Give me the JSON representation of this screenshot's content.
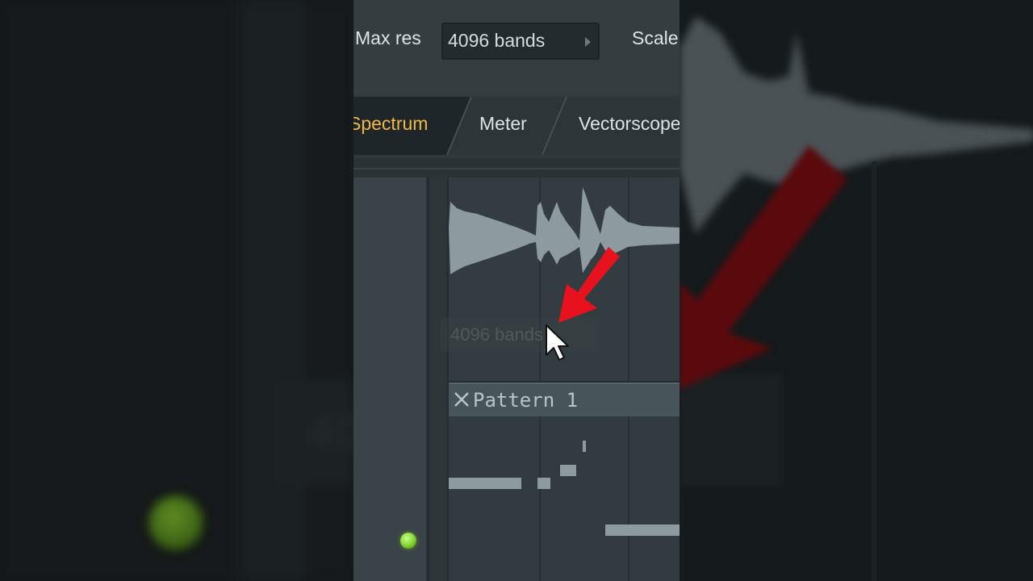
{
  "toolbar": {
    "max_res_label": "Max res",
    "bands_value": "4096 bands",
    "scale_label": "Scale"
  },
  "tabs": [
    {
      "label": "Spectrum",
      "active": true
    },
    {
      "label": "Meter",
      "active": false
    },
    {
      "label": "Vectorscope",
      "active": false
    }
  ],
  "playlist": {
    "ghost_field_text": "4096 bands",
    "pattern_label": "Pattern 1"
  },
  "icons": [
    "close-icon",
    "mouse-cursor-icon",
    "red-arrow-icon",
    "status-led-icon",
    "knob-icon",
    "chevron-right-icon"
  ],
  "colors": {
    "active_tab_text": "#f0b848",
    "annotation_arrow": "#e8121e",
    "led_green": "#7ed12f",
    "waveform": "#8d9ba1"
  },
  "background_blur": {
    "ghost_text": "40"
  }
}
